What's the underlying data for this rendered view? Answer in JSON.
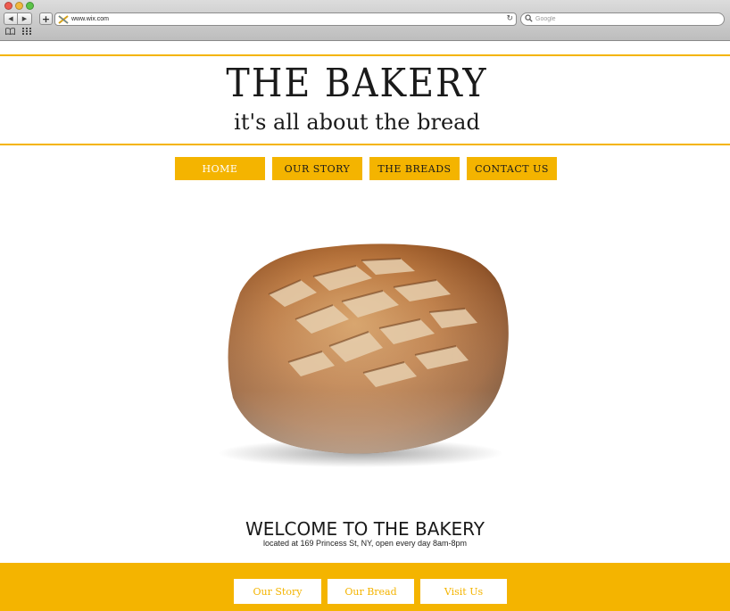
{
  "browser": {
    "url": "www.wix.com",
    "search_placeholder": "Google",
    "back_glyph": "◀",
    "forward_glyph": "▶",
    "add_glyph": "+",
    "reload_glyph": "↻",
    "search_glyph": "🔍",
    "bookmarks_glyph": "📖",
    "grid_glyph": "▦"
  },
  "site": {
    "title": "THE BAKERY",
    "tagline": "it's all about the bread",
    "accent_color": "#f4b400"
  },
  "nav": {
    "items": [
      {
        "label": "HOME"
      },
      {
        "label": "OUR STORY"
      },
      {
        "label": "THE BREADS"
      },
      {
        "label": "CONTACT US"
      }
    ]
  },
  "welcome": {
    "title": "WELCOME TO THE BAKERY",
    "subtitle": "located at 169 Princess St, NY, open every day 8am-8pm"
  },
  "footer": {
    "links": [
      {
        "label": "Our Story"
      },
      {
        "label": "Our Bread"
      },
      {
        "label": "Visit Us"
      }
    ]
  }
}
